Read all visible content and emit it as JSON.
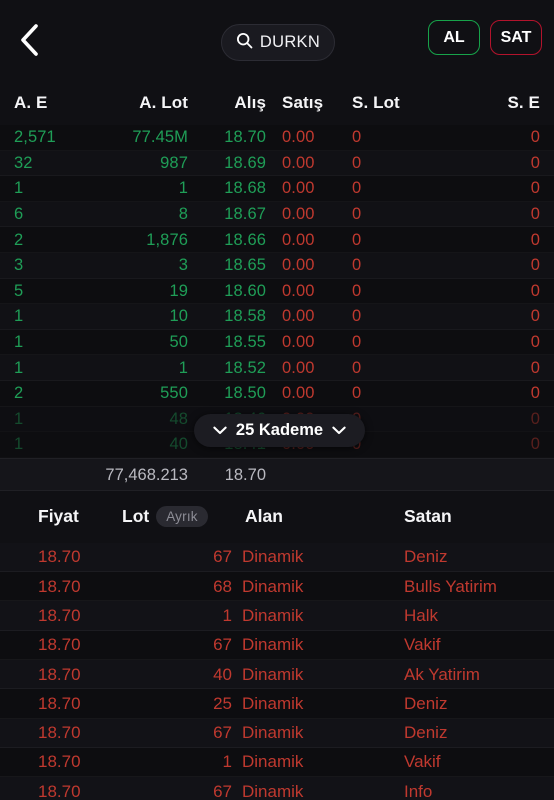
{
  "header": {
    "back_icon": "chevron-left-icon",
    "search": {
      "icon": "search-icon",
      "value": "DURKN"
    },
    "buy_label": "AL",
    "sell_label": "SAT",
    "buy_color": "#17a34a",
    "sell_color": "#b3132c"
  },
  "depth": {
    "columns": [
      "A. E",
      "A. Lot",
      "Alış",
      "Satış",
      "S. Lot",
      "S. E"
    ],
    "rows": [
      {
        "ae": "2,571",
        "alot": "77.45M",
        "alis": "18.70",
        "satis": "0.00",
        "slot": "0",
        "se": "0"
      },
      {
        "ae": "32",
        "alot": "987",
        "alis": "18.69",
        "satis": "0.00",
        "slot": "0",
        "se": "0"
      },
      {
        "ae": "1",
        "alot": "1",
        "alis": "18.68",
        "satis": "0.00",
        "slot": "0",
        "se": "0"
      },
      {
        "ae": "6",
        "alot": "8",
        "alis": "18.67",
        "satis": "0.00",
        "slot": "0",
        "se": "0"
      },
      {
        "ae": "2",
        "alot": "1,876",
        "alis": "18.66",
        "satis": "0.00",
        "slot": "0",
        "se": "0"
      },
      {
        "ae": "3",
        "alot": "3",
        "alis": "18.65",
        "satis": "0.00",
        "slot": "0",
        "se": "0"
      },
      {
        "ae": "5",
        "alot": "19",
        "alis": "18.60",
        "satis": "0.00",
        "slot": "0",
        "se": "0"
      },
      {
        "ae": "1",
        "alot": "10",
        "alis": "18.58",
        "satis": "0.00",
        "slot": "0",
        "se": "0"
      },
      {
        "ae": "1",
        "alot": "50",
        "alis": "18.55",
        "satis": "0.00",
        "slot": "0",
        "se": "0"
      },
      {
        "ae": "1",
        "alot": "1",
        "alis": "18.52",
        "satis": "0.00",
        "slot": "0",
        "se": "0"
      },
      {
        "ae": "2",
        "alot": "550",
        "alis": "18.50",
        "satis": "0.00",
        "slot": "0",
        "se": "0"
      },
      {
        "ae": "1",
        "alot": "48",
        "alis": "18.46",
        "satis": "0.00",
        "slot": "0",
        "se": "0"
      },
      {
        "ae": "1",
        "alot": "40",
        "alis": "18.41",
        "satis": "0.00",
        "slot": "0",
        "se": "0"
      }
    ],
    "kademe_label": "25 Kademe",
    "kademe_left_icon": "chevron-down-icon",
    "kademe_right_icon": "chevron-down-icon",
    "summary": {
      "total_lot": "77,468.213",
      "price": "18.70"
    }
  },
  "trades": {
    "columns": {
      "fiyat": "Fiyat",
      "lot": "Lot",
      "lot_badge": "Ayrık",
      "alan": "Alan",
      "satan": "Satan"
    },
    "rows": [
      {
        "fiyat": "18.70",
        "lot": "67",
        "alan": "Dinamik",
        "satan": "Deniz"
      },
      {
        "fiyat": "18.70",
        "lot": "68",
        "alan": "Dinamik",
        "satan": "Bulls Yatirim"
      },
      {
        "fiyat": "18.70",
        "lot": "1",
        "alan": "Dinamik",
        "satan": "Halk"
      },
      {
        "fiyat": "18.70",
        "lot": "67",
        "alan": "Dinamik",
        "satan": "Vakif"
      },
      {
        "fiyat": "18.70",
        "lot": "40",
        "alan": "Dinamik",
        "satan": "Ak Yatirim"
      },
      {
        "fiyat": "18.70",
        "lot": "25",
        "alan": "Dinamik",
        "satan": "Deniz"
      },
      {
        "fiyat": "18.70",
        "lot": "67",
        "alan": "Dinamik",
        "satan": "Deniz"
      },
      {
        "fiyat": "18.70",
        "lot": "1",
        "alan": "Dinamik",
        "satan": "Vakif"
      },
      {
        "fiyat": "18.70",
        "lot": "67",
        "alan": "Dinamik",
        "satan": "Info"
      }
    ]
  },
  "colors": {
    "buy_green": "#1f9e57",
    "sell_red": "#c0392f",
    "background": "#0d0d10"
  }
}
